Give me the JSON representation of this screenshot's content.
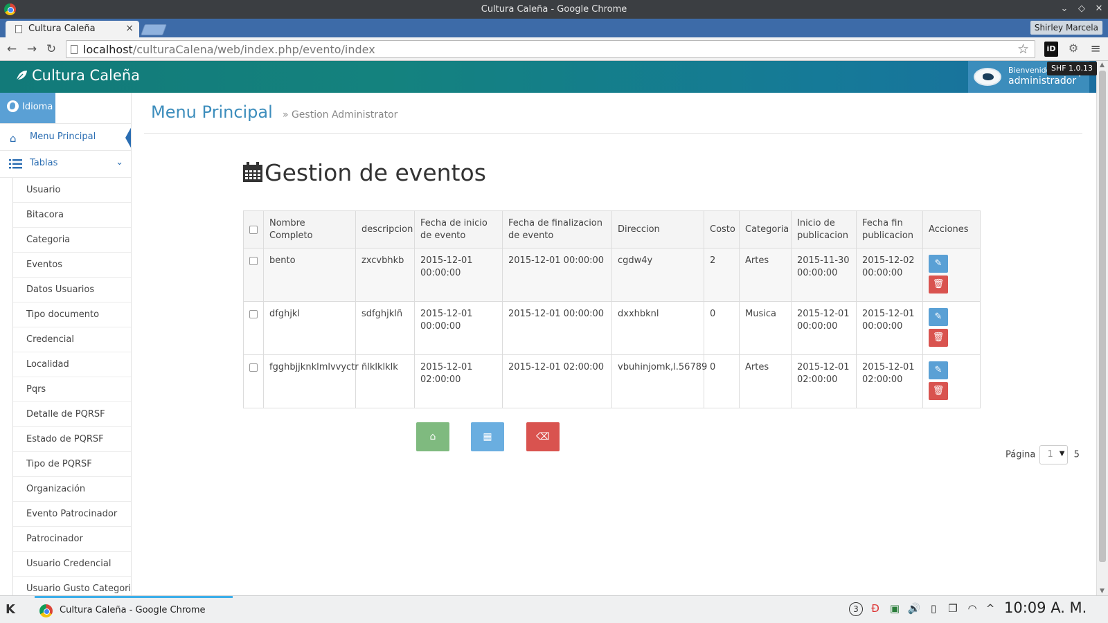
{
  "window": {
    "title": "Cultura Caleña - Google Chrome"
  },
  "browser": {
    "tab_title": "Cultura Caleña",
    "tab_close": "×",
    "profile": "Shirley Marcela",
    "url_host": "localhost",
    "url_path": "/culturaCalena/web/index.php/evento/index",
    "ext_id": "iD"
  },
  "header": {
    "brand": "Cultura Caleña",
    "welcome": "Bienvenido",
    "username": "administrador",
    "badge": "SHF 1.0.13"
  },
  "sidebar": {
    "language": "Idioma",
    "main_menu": "Menu Principal",
    "tables": "Tablas",
    "items": [
      "Usuario",
      "Bitacora",
      "Categoria",
      "Eventos",
      "Datos Usuarios",
      "Tipo documento",
      "Credencial",
      "Localidad",
      "Pqrs",
      "Detalle de PQRSF",
      "Estado de PQRSF",
      "Tipo de PQRSF",
      "Organización",
      "Evento Patrocinador",
      "Patrocinador",
      "Usuario Credencial",
      "Usuario Gusto Categoria"
    ]
  },
  "breadcrumb": {
    "title": "Menu Principal",
    "sub": "» Gestion Administrator"
  },
  "page": {
    "title": "Gestion de eventos"
  },
  "table": {
    "columns": [
      "Nombre Completo",
      "descripcion",
      "Fecha de inicio de evento",
      "Fecha de finalizacion de evento",
      "Direccion",
      "Costo",
      "Categoria",
      "Inicio de publicacion",
      "Fecha fin publicacion",
      "Acciones"
    ],
    "rows": [
      [
        "bento",
        "zxcvbhkb",
        "2015-12-01 00:00:00",
        "2015-12-01 00:00:00",
        "cgdw4y",
        "2",
        "Artes",
        "2015-11-30 00:00:00",
        "2015-12-02 00:00:00"
      ],
      [
        "dfghjkl",
        "sdfghjklñ",
        "2015-12-01 00:00:00",
        "2015-12-01 00:00:00",
        "dxxhbknl",
        "0",
        "Musica",
        "2015-12-01 00:00:00",
        "2015-12-01 00:00:00"
      ],
      [
        "fgghbjjknklmlvvyctr",
        "ñlklklklk",
        "2015-12-01 02:00:00",
        "2015-12-01 02:00:00",
        "vbuhinjomk,l.56789",
        "0",
        "Artes",
        "2015-12-01 02:00:00",
        "2015-12-01 02:00:00"
      ]
    ]
  },
  "pager": {
    "label": "Página",
    "current": "1",
    "total": "5"
  },
  "taskbar": {
    "task_label": "Cultura Caleña - Google Chrome",
    "clock": "10:09 A. M.",
    "tray_badge": "3"
  },
  "colors": {
    "primary": "#3c8dbc",
    "edit": "#5aa0d5",
    "delete": "#d9534f",
    "home": "#7fba7f"
  }
}
